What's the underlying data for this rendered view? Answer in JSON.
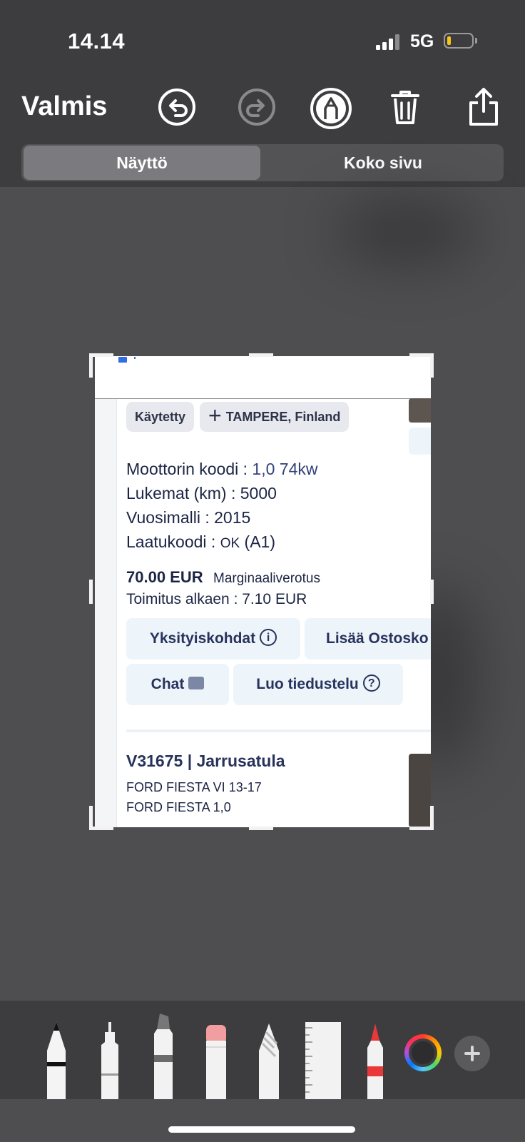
{
  "status_bar": {
    "time": "14.14",
    "network": "5G"
  },
  "toolbar": {
    "done_label": "Valmis",
    "icons": [
      "undo-icon",
      "redo-icon",
      "markup-pen-icon",
      "trash-icon",
      "share-icon"
    ]
  },
  "segmented": {
    "tabs": [
      "Näyttö",
      "Koko sivu"
    ],
    "selected": "Näyttö"
  },
  "page": {
    "chips": {
      "condition": "Käytetty",
      "location": "TAMPERE, Finland"
    },
    "specs": {
      "engine_label": "Moottorin koodi : ",
      "engine_value": "1,0 74kw",
      "mileage": "Lukemat (km) : 5000",
      "year": "Vuosimalli : 2015",
      "quality_label": "Laatukoodi : ",
      "quality_value": "OK",
      "quality_suffix": " (A1)"
    },
    "price": "70.00 EUR",
    "price_note": "Marginaaliverotus",
    "delivery": "Toimitus alkaen : 7.10 EUR",
    "buttons": {
      "details": "Yksityiskohdat",
      "add_cart": "Lisää Ostosko",
      "chat": "Chat",
      "inquiry": "Luo tiedustelu"
    },
    "next_item": {
      "title": "V31675 | Jarrusatula",
      "line1": "FORD FIESTA VI 13-17",
      "line2": "FORD FIESTA 1,0"
    }
  },
  "tools": [
    "pen-tool",
    "fineliner-tool",
    "marker-tool",
    "eraser-tool",
    "lasso-tool",
    "ruler-tool",
    "crayon-tool"
  ],
  "battery_level": 0.15,
  "accent_colors": {
    "selected_segment": "#7b7b7f",
    "link_blue": "#28335c",
    "battery": "#f5c518"
  }
}
